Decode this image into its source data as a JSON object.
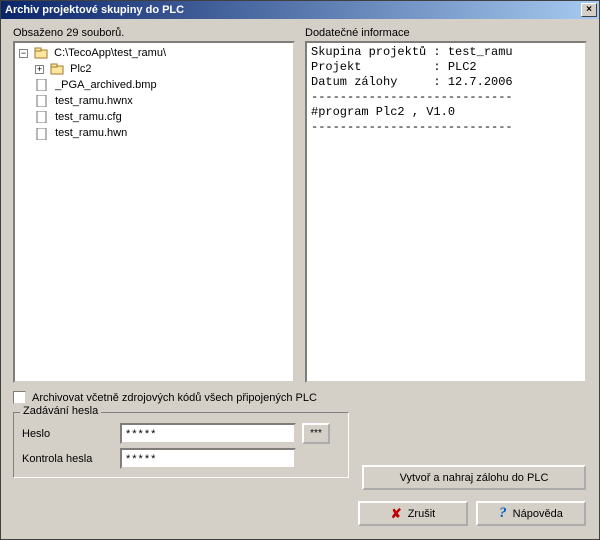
{
  "window": {
    "title": "Archiv projektové skupiny do PLC"
  },
  "left": {
    "label": "Obsaženo 29 souborů.",
    "tree": {
      "root": "C:\\TecoApp\\test_ramu\\",
      "items": [
        {
          "label": "Plc2",
          "type": "folder",
          "expandable": true
        },
        {
          "label": "_PGA_archived.bmp",
          "type": "file"
        },
        {
          "label": "test_ramu.hwnx",
          "type": "file"
        },
        {
          "label": "test_ramu.cfg",
          "type": "file"
        },
        {
          "label": "test_ramu.hwn",
          "type": "file"
        }
      ]
    }
  },
  "right": {
    "label": "Dodatečné informace",
    "lines": [
      "Skupina projektů : test_ramu",
      "Projekt          : PLC2",
      "Datum zálohy     : 12.7.2006",
      "----------------------------",
      "#program Plc2 , V1.0",
      "----------------------------"
    ]
  },
  "checkbox": {
    "label": "Archivovat včetně zdrojových kódů všech připojených PLC",
    "checked": false
  },
  "password": {
    "legend": "Zadávání hesla",
    "label1": "Heslo",
    "label2": "Kontrola hesla",
    "value1": "*****",
    "value2": "*****",
    "browse": "***"
  },
  "buttons": {
    "upload": "Vytvoř a nahraj zálohu do PLC",
    "cancel": "Zrušit",
    "help": "Nápověda"
  }
}
